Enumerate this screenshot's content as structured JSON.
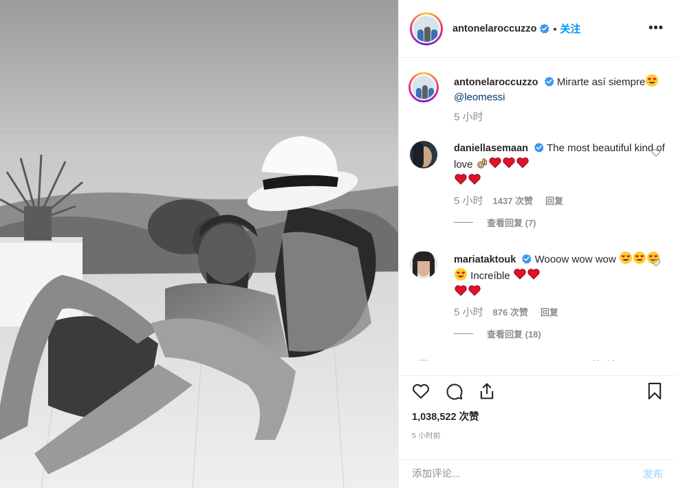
{
  "header": {
    "username": "antonelaroccuzzo",
    "separator": "•",
    "follow_label": "关注",
    "more_label": "•••"
  },
  "caption": {
    "username": "antonelaroccuzzo",
    "text": "Mirarte así siempre",
    "mention": "@leomessi",
    "time": "5 小时"
  },
  "comments": [
    {
      "username": "daniellasemaan",
      "text": "The most beautiful kind of love",
      "time": "5 小时",
      "likes": "1437 次赞",
      "reply_label": "回复",
      "view_replies": "查看回复 (7)"
    },
    {
      "username": "mariataktouk",
      "text_a": "Wooow wow wow",
      "text_b": "Increíble",
      "time": "5 小时",
      "likes": "876 次赞",
      "reply_label": "回复",
      "view_replies": "查看回复 (18)"
    }
  ],
  "footer": {
    "likes_count": "1,038,522 次赞",
    "time_ago": "5 小时前",
    "comment_placeholder": "添加评论...",
    "post_label": "发布"
  },
  "colors": {
    "accent": "#0095f6",
    "verified": "#3897f0",
    "heart": "#e0112b",
    "muted": "#8e8e8e",
    "post_disabled": "#b2dffc"
  },
  "icons": [
    "verified-badge-icon",
    "more-options-icon",
    "heart-icon",
    "comment-icon",
    "share-icon",
    "bookmark-icon"
  ]
}
